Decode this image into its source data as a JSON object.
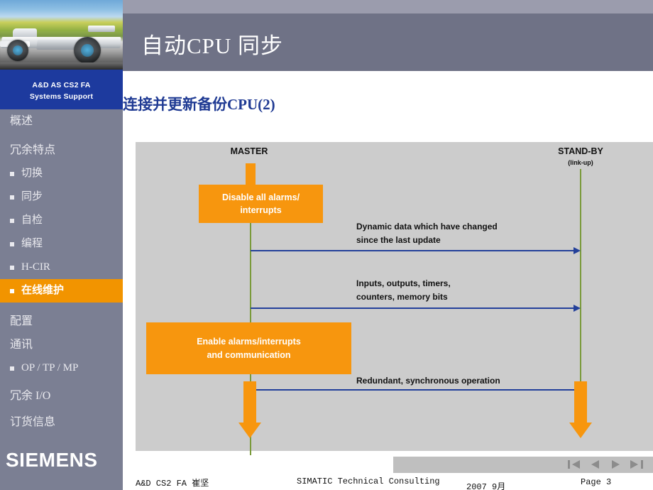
{
  "sidebar": {
    "department_line1": "A&D AS CS2 FA",
    "department_line2": "Systems Support",
    "logo": "SIEMENS",
    "items": [
      {
        "label": "概述",
        "sub": false,
        "active": false
      },
      {
        "label": "冗余特点",
        "sub": false,
        "active": false
      },
      {
        "label": "切换",
        "sub": true,
        "active": false
      },
      {
        "label": "同步",
        "sub": true,
        "active": false
      },
      {
        "label": "自检",
        "sub": true,
        "active": false
      },
      {
        "label": "编程",
        "sub": true,
        "active": false
      },
      {
        "label": "H-CIR",
        "sub": true,
        "active": false
      },
      {
        "label": "在线维护",
        "sub": true,
        "active": true
      },
      {
        "label": "配置",
        "sub": false,
        "active": false
      },
      {
        "label": "通讯",
        "sub": false,
        "active": false
      },
      {
        "label": "OP / TP / MP",
        "sub": true,
        "active": false
      },
      {
        "label": "冗余 I/O",
        "sub": false,
        "active": false
      },
      {
        "label": "订货信息",
        "sub": false,
        "active": false
      }
    ]
  },
  "header": {
    "title": "自动CPU 同步",
    "subtitle": "连接并更新备份CPU(2)"
  },
  "diagram": {
    "master_label": "MASTER",
    "standby_label": "STAND-BY",
    "standby_sublabel": "(link-up)",
    "box_disable": "Disable all alarms/\ninterrupts",
    "box_disable_line1": "Disable all alarms/",
    "box_disable_line2": "interrupts",
    "box_enable_line1": "Enable alarms/interrupts",
    "box_enable_line2": "and communication",
    "msg1_line1": "Dynamic data which have changed",
    "msg1_line2": "since the last update",
    "msg2_line1": "Inputs, outputs, timers,",
    "msg2_line2": "counters, memory bits",
    "msg3_line1": "Redundant, synchronous operation",
    "colors": {
      "background": "#cccccc",
      "lifeline": "#7a9a3a",
      "box": "#f7960e",
      "message": "#23409a"
    }
  },
  "footer": {
    "author": "A&D CS2  FA  崔坚",
    "center": "SIMATIC Technical Consulting",
    "date": "2007 9月",
    "page": "Page 3",
    "nav": {
      "first": "first-slide",
      "prev": "previous-slide",
      "next": "next-slide",
      "last": "last-slide"
    }
  }
}
